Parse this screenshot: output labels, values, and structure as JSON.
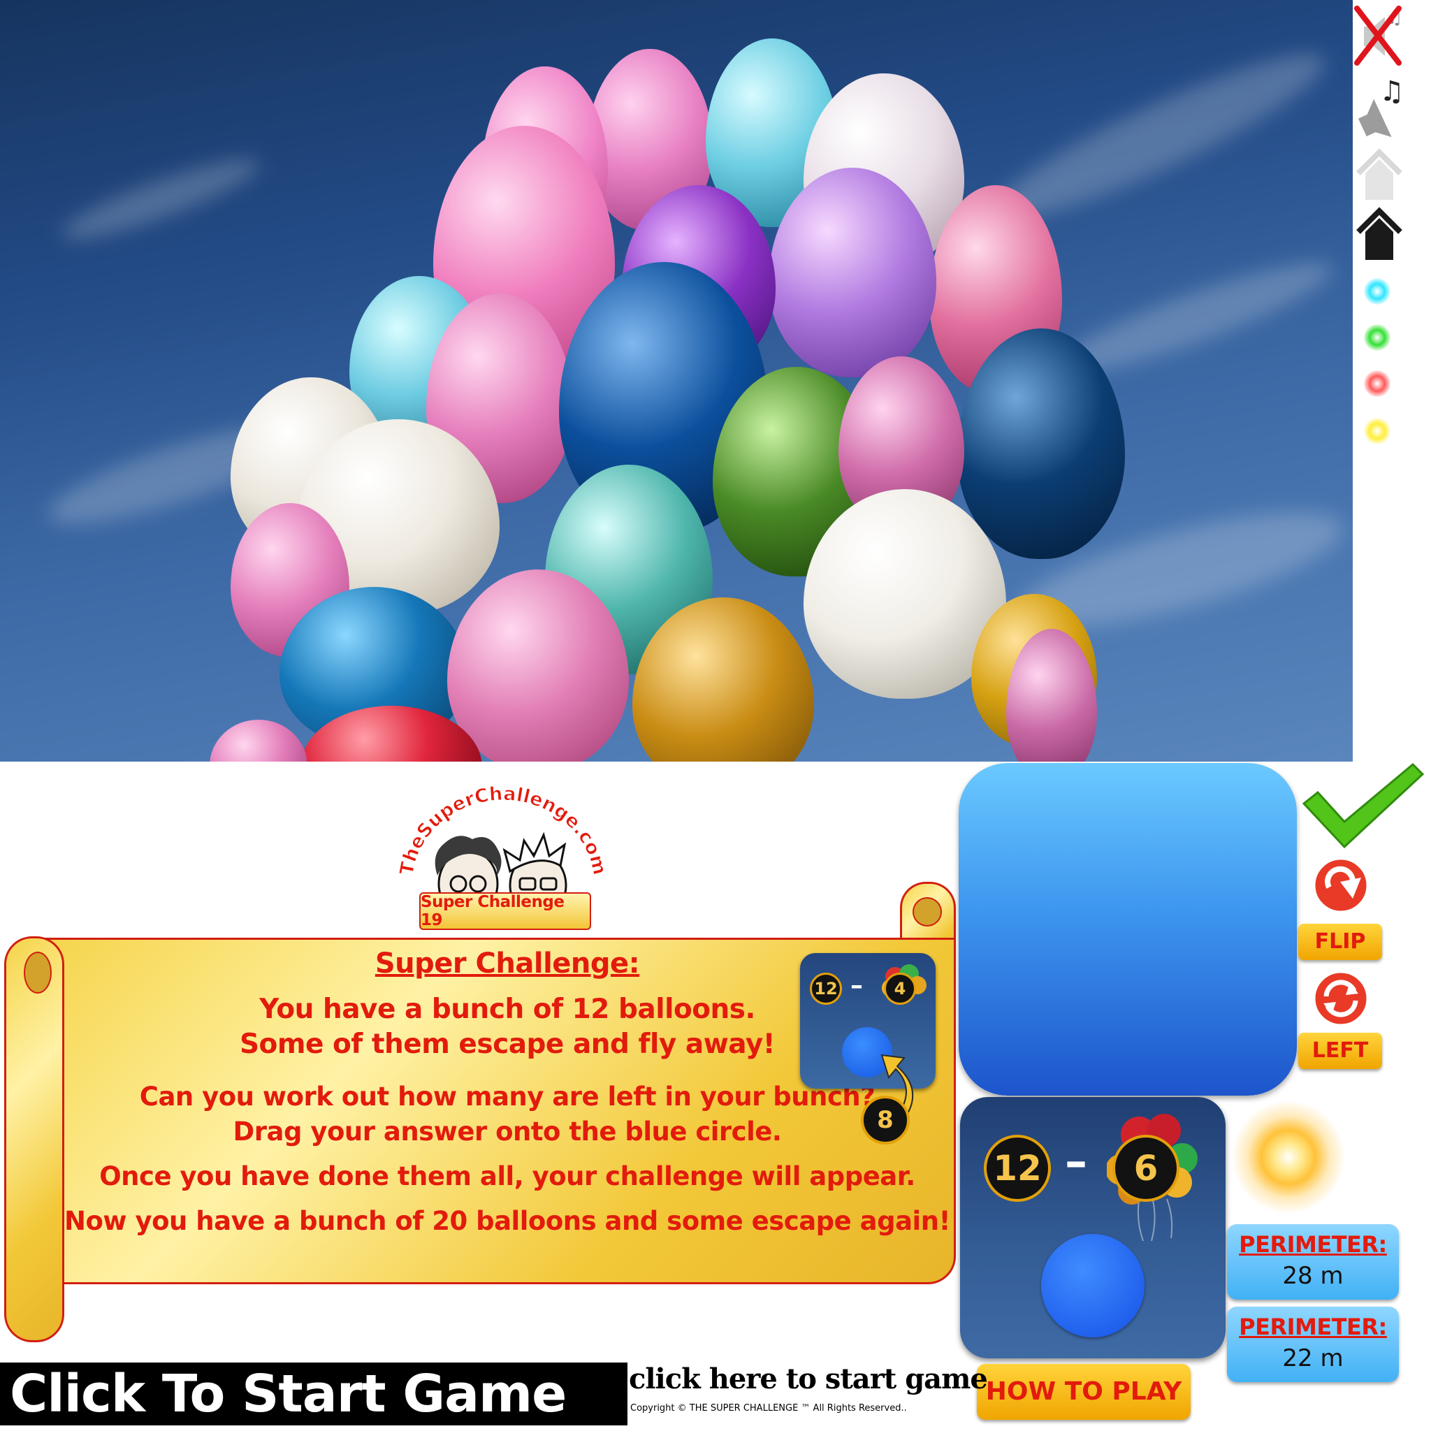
{
  "game": {
    "logo": {
      "text": "TheSuperChallenge.com",
      "badge": "Super Challenge 19"
    },
    "scroll": {
      "heading": "Super Challenge:",
      "lines": [
        "You have a bunch of 12 balloons.",
        "Some of them escape and fly away!",
        "Can you work out how many are left in your bunch?",
        "Drag your answer onto the blue circle.",
        "Once you have done them all, your challenge will appear.",
        "Now you have a bunch of 20 balloons and some escape again!"
      ]
    },
    "example_card": {
      "start": "12",
      "minus": "–",
      "escaped": "4",
      "answer": "8"
    },
    "challenge_card": {
      "start": "12",
      "minus": "–",
      "escaped": "6"
    },
    "buttons": {
      "flip": "FLIP",
      "left": "LEFT",
      "how_to_play": "HOW TO PLAY"
    },
    "perimeters": [
      {
        "label": "PERIMETER:",
        "value": "28 m"
      },
      {
        "label": "PERIMETER:",
        "value": "22 m"
      }
    ],
    "start_banner": "Click To Start Game",
    "start_link": "click here to start game",
    "copyright": "Copyright © THE SUPER CHALLENGE ™ All Rights Reserved.."
  },
  "toolbar": {
    "icons": [
      "sound-off-icon",
      "sound-on-icon",
      "home-light-icon",
      "home-dark-icon"
    ],
    "dot_colors": [
      "#2fe6ff",
      "#35e035",
      "#ff5a5a",
      "#ffee3a"
    ]
  },
  "colors": {
    "accent_red": "#e21b0d",
    "gold": "#f5c84a",
    "tile_blue": "#2f66cc",
    "card_navy": "#28477a"
  }
}
